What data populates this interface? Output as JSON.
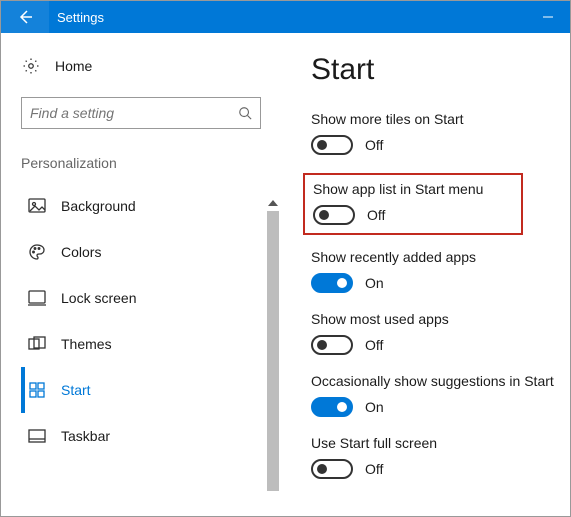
{
  "titlebar": {
    "title": "Settings"
  },
  "sidebar": {
    "home_label": "Home",
    "search_placeholder": "Find a setting",
    "section_label": "Personalization",
    "items": [
      {
        "label": "Background"
      },
      {
        "label": "Colors"
      },
      {
        "label": "Lock screen"
      },
      {
        "label": "Themes"
      },
      {
        "label": "Start"
      },
      {
        "label": "Taskbar"
      }
    ]
  },
  "main": {
    "page_title": "Start",
    "settings": [
      {
        "label": "Show more tiles on Start",
        "state": "Off"
      },
      {
        "label": "Show app list in Start menu",
        "state": "Off"
      },
      {
        "label": "Show recently added apps",
        "state": "On"
      },
      {
        "label": "Show most used apps",
        "state": "Off"
      },
      {
        "label": "Occasionally show suggestions in Start",
        "state": "On"
      },
      {
        "label": "Use Start full screen",
        "state": "Off"
      }
    ]
  }
}
